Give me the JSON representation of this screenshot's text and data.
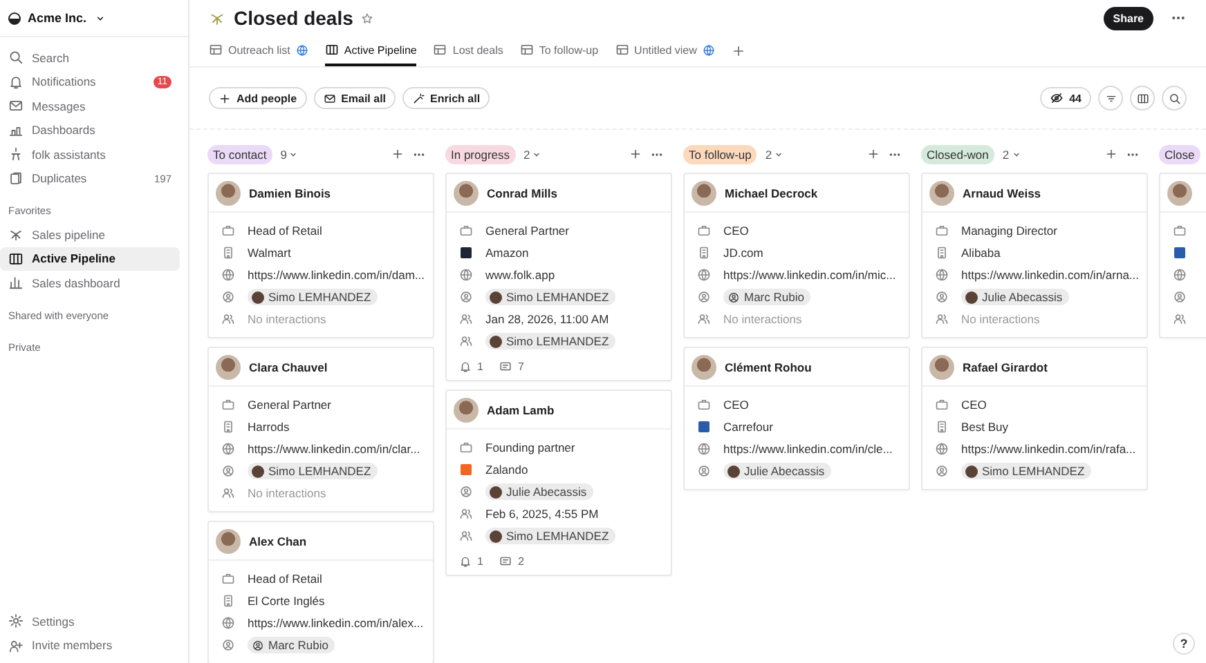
{
  "workspace": {
    "name": "Acme Inc."
  },
  "sidebar": {
    "items": [
      {
        "label": "Search",
        "selected": false
      },
      {
        "label": "Notifications",
        "badge": "11",
        "selected": false
      },
      {
        "label": "Messages",
        "selected": false
      },
      {
        "label": "Dashboards",
        "selected": false
      },
      {
        "label": "folk assistants",
        "selected": false
      },
      {
        "label": "Duplicates",
        "count": "197",
        "selected": false
      }
    ],
    "sections": [
      {
        "title": "Favorites",
        "items": [
          {
            "label": "Sales pipeline",
            "selected": false
          },
          {
            "label": "Active Pipeline",
            "selected": true
          },
          {
            "label": "Sales dashboard",
            "selected": false
          }
        ]
      },
      {
        "title": "Shared with everyone"
      },
      {
        "title": "Private"
      }
    ],
    "footer": [
      {
        "label": "Settings"
      },
      {
        "label": "Invite members"
      }
    ]
  },
  "page": {
    "title": "Closed deals",
    "share": "Share"
  },
  "tabs": [
    {
      "label": "Outreach list",
      "shared": true,
      "selected": false
    },
    {
      "label": "Active Pipeline",
      "shared": false,
      "selected": true
    },
    {
      "label": "Lost deals",
      "shared": false,
      "selected": false
    },
    {
      "label": "To follow-up",
      "shared": false,
      "selected": false
    },
    {
      "label": "Untitled view",
      "shared": true,
      "selected": false
    }
  ],
  "toolbar": {
    "actions": [
      {
        "label": "Add people"
      },
      {
        "label": "Email all"
      },
      {
        "label": "Enrich all"
      }
    ],
    "hidden_count": "44"
  },
  "columns": [
    {
      "label": "To contact",
      "count": "9",
      "color": "#ead9f7",
      "cards": [
        {
          "name": "Damien Binois",
          "fields": [
            {
              "kind": "role",
              "text": "Head of Retail"
            },
            {
              "kind": "company",
              "text": "Walmart"
            },
            {
              "kind": "link",
              "text": "https://www.linkedin.com/in/dam..."
            },
            {
              "kind": "owner",
              "text": "Simo LEMHANDEZ",
              "photo": true
            },
            {
              "kind": "interactions",
              "text": "No interactions"
            }
          ]
        },
        {
          "name": "Clara Chauvel",
          "fields": [
            {
              "kind": "role",
              "text": "General Partner"
            },
            {
              "kind": "company",
              "text": "Harrods"
            },
            {
              "kind": "link",
              "text": "https://www.linkedin.com/in/clar..."
            },
            {
              "kind": "owner",
              "text": "Simo LEMHANDEZ",
              "photo": true
            },
            {
              "kind": "interactions",
              "text": "No interactions"
            }
          ]
        },
        {
          "name": "Alex Chan",
          "fields": [
            {
              "kind": "role",
              "text": "Head of Retail"
            },
            {
              "kind": "company",
              "text": "El Corte Inglés"
            },
            {
              "kind": "link",
              "text": "https://www.linkedin.com/in/alex..."
            },
            {
              "kind": "owner",
              "text": "Marc Rubio",
              "photo": false
            }
          ]
        }
      ]
    },
    {
      "label": "In progress",
      "count": "2",
      "color": "#f8d9e2",
      "cards": [
        {
          "name": "Conrad Mills",
          "fields": [
            {
              "kind": "role",
              "text": "General Partner"
            },
            {
              "kind": "brand",
              "text": "Amazon",
              "color": "#1f2633"
            },
            {
              "kind": "link",
              "text": "www.folk.app"
            },
            {
              "kind": "owner",
              "text": "Simo LEMHANDEZ",
              "photo": true
            },
            {
              "kind": "date",
              "text": "Jan 28, 2026, 11:00 AM"
            },
            {
              "kind": "contact",
              "text": "Simo LEMHANDEZ",
              "photo": true
            }
          ],
          "reminders": "1",
          "comments": "7"
        },
        {
          "name": "Adam Lamb",
          "fields": [
            {
              "kind": "role",
              "text": "Founding partner"
            },
            {
              "kind": "brand",
              "text": "Zalando",
              "color": "#f26522"
            },
            {
              "kind": "owner",
              "text": "Julie Abecassis",
              "photo": true
            },
            {
              "kind": "date",
              "text": "Feb 6, 2025, 4:55 PM"
            },
            {
              "kind": "contact",
              "text": "Simo LEMHANDEZ",
              "photo": true
            }
          ],
          "reminders": "1",
          "comments": "2"
        }
      ]
    },
    {
      "label": "To follow-up",
      "count": "2",
      "color": "#fcd9bd",
      "cards": [
        {
          "name": "Michael Decrock",
          "fields": [
            {
              "kind": "role",
              "text": "CEO"
            },
            {
              "kind": "company",
              "text": "JD.com"
            },
            {
              "kind": "link",
              "text": "https://www.linkedin.com/in/mic..."
            },
            {
              "kind": "owner",
              "text": "Marc Rubio",
              "photo": false
            },
            {
              "kind": "interactions",
              "text": "No interactions"
            }
          ]
        },
        {
          "name": "Clément Rohou",
          "fields": [
            {
              "kind": "role",
              "text": "CEO"
            },
            {
              "kind": "brand",
              "text": "Carrefour",
              "color": "#2a5caa"
            },
            {
              "kind": "link",
              "text": "https://www.linkedin.com/in/cle..."
            },
            {
              "kind": "owner",
              "text": "Julie Abecassis",
              "photo": true
            }
          ]
        }
      ]
    },
    {
      "label": "Closed-won",
      "count": "2",
      "color": "#d5eadb",
      "cards": [
        {
          "name": "Arnaud Weiss",
          "fields": [
            {
              "kind": "role",
              "text": "Managing Director"
            },
            {
              "kind": "company",
              "text": "Alibaba"
            },
            {
              "kind": "link",
              "text": "https://www.linkedin.com/in/arna..."
            },
            {
              "kind": "owner",
              "text": "Julie Abecassis",
              "photo": true
            },
            {
              "kind": "interactions",
              "text": "No interactions"
            }
          ]
        },
        {
          "name": "Rafael Girardot",
          "fields": [
            {
              "kind": "role",
              "text": "CEO"
            },
            {
              "kind": "company",
              "text": "Best Buy"
            },
            {
              "kind": "link",
              "text": "https://www.linkedin.com/in/rafa..."
            },
            {
              "kind": "owner",
              "text": "Simo LEMHANDEZ",
              "photo": true
            }
          ]
        }
      ]
    },
    {
      "label": "Close",
      "color": "#ead9f7",
      "cards": [
        {
          "fields": [
            {
              "kind": "role"
            },
            {
              "kind": "brand",
              "color": "#2a5caa"
            },
            {
              "kind": "link"
            },
            {
              "kind": "owner"
            },
            {
              "kind": "interactions"
            }
          ]
        }
      ]
    }
  ],
  "help": "?"
}
